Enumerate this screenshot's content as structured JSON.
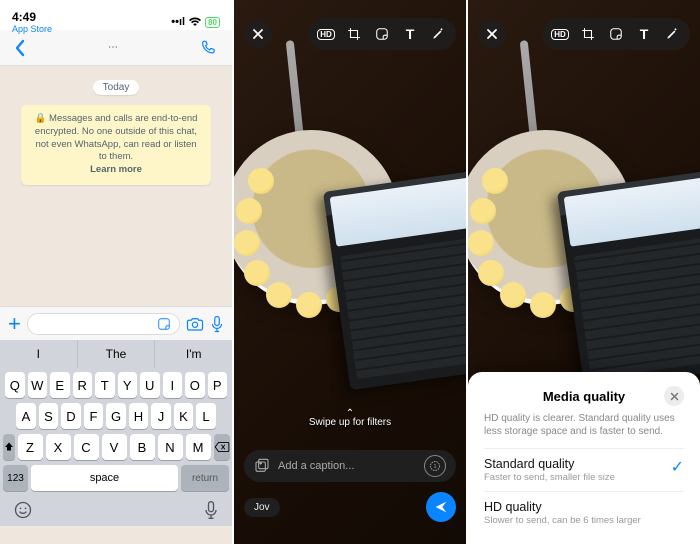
{
  "panel1": {
    "status": {
      "time": "4:49",
      "back_label": "App Store",
      "battery": "80"
    },
    "header": {},
    "today_label": "Today",
    "e2e_text": "Messages and calls are end-to-end encrypted. No one outside of this chat, not even WhatsApp, can read or listen to them.",
    "e2e_learn_more": "Learn more",
    "suggestions": [
      "I",
      "The",
      "I'm"
    ],
    "keyboard": {
      "row1": [
        "Q",
        "W",
        "E",
        "R",
        "T",
        "Y",
        "U",
        "I",
        "O",
        "P"
      ],
      "row2": [
        "A",
        "S",
        "D",
        "F",
        "G",
        "H",
        "J",
        "K",
        "L"
      ],
      "row3": [
        "Z",
        "X",
        "C",
        "V",
        "B",
        "N",
        "M"
      ],
      "n123": "123",
      "space": "space",
      "return": "return"
    }
  },
  "panel2": {
    "swipe_hint": "Swipe up for filters",
    "caption_placeholder": "Add a caption...",
    "recipient_chip": "Jov"
  },
  "panel3": {
    "sheet": {
      "title": "Media quality",
      "subtitle": "HD quality is clearer. Standard quality uses less storage space and is faster to send.",
      "options": [
        {
          "title": "Standard quality",
          "sub": "Faster to send, smaller file size",
          "selected": true
        },
        {
          "title": "HD quality",
          "sub": "Slower to send, can be 6 times larger",
          "selected": false
        }
      ]
    }
  }
}
